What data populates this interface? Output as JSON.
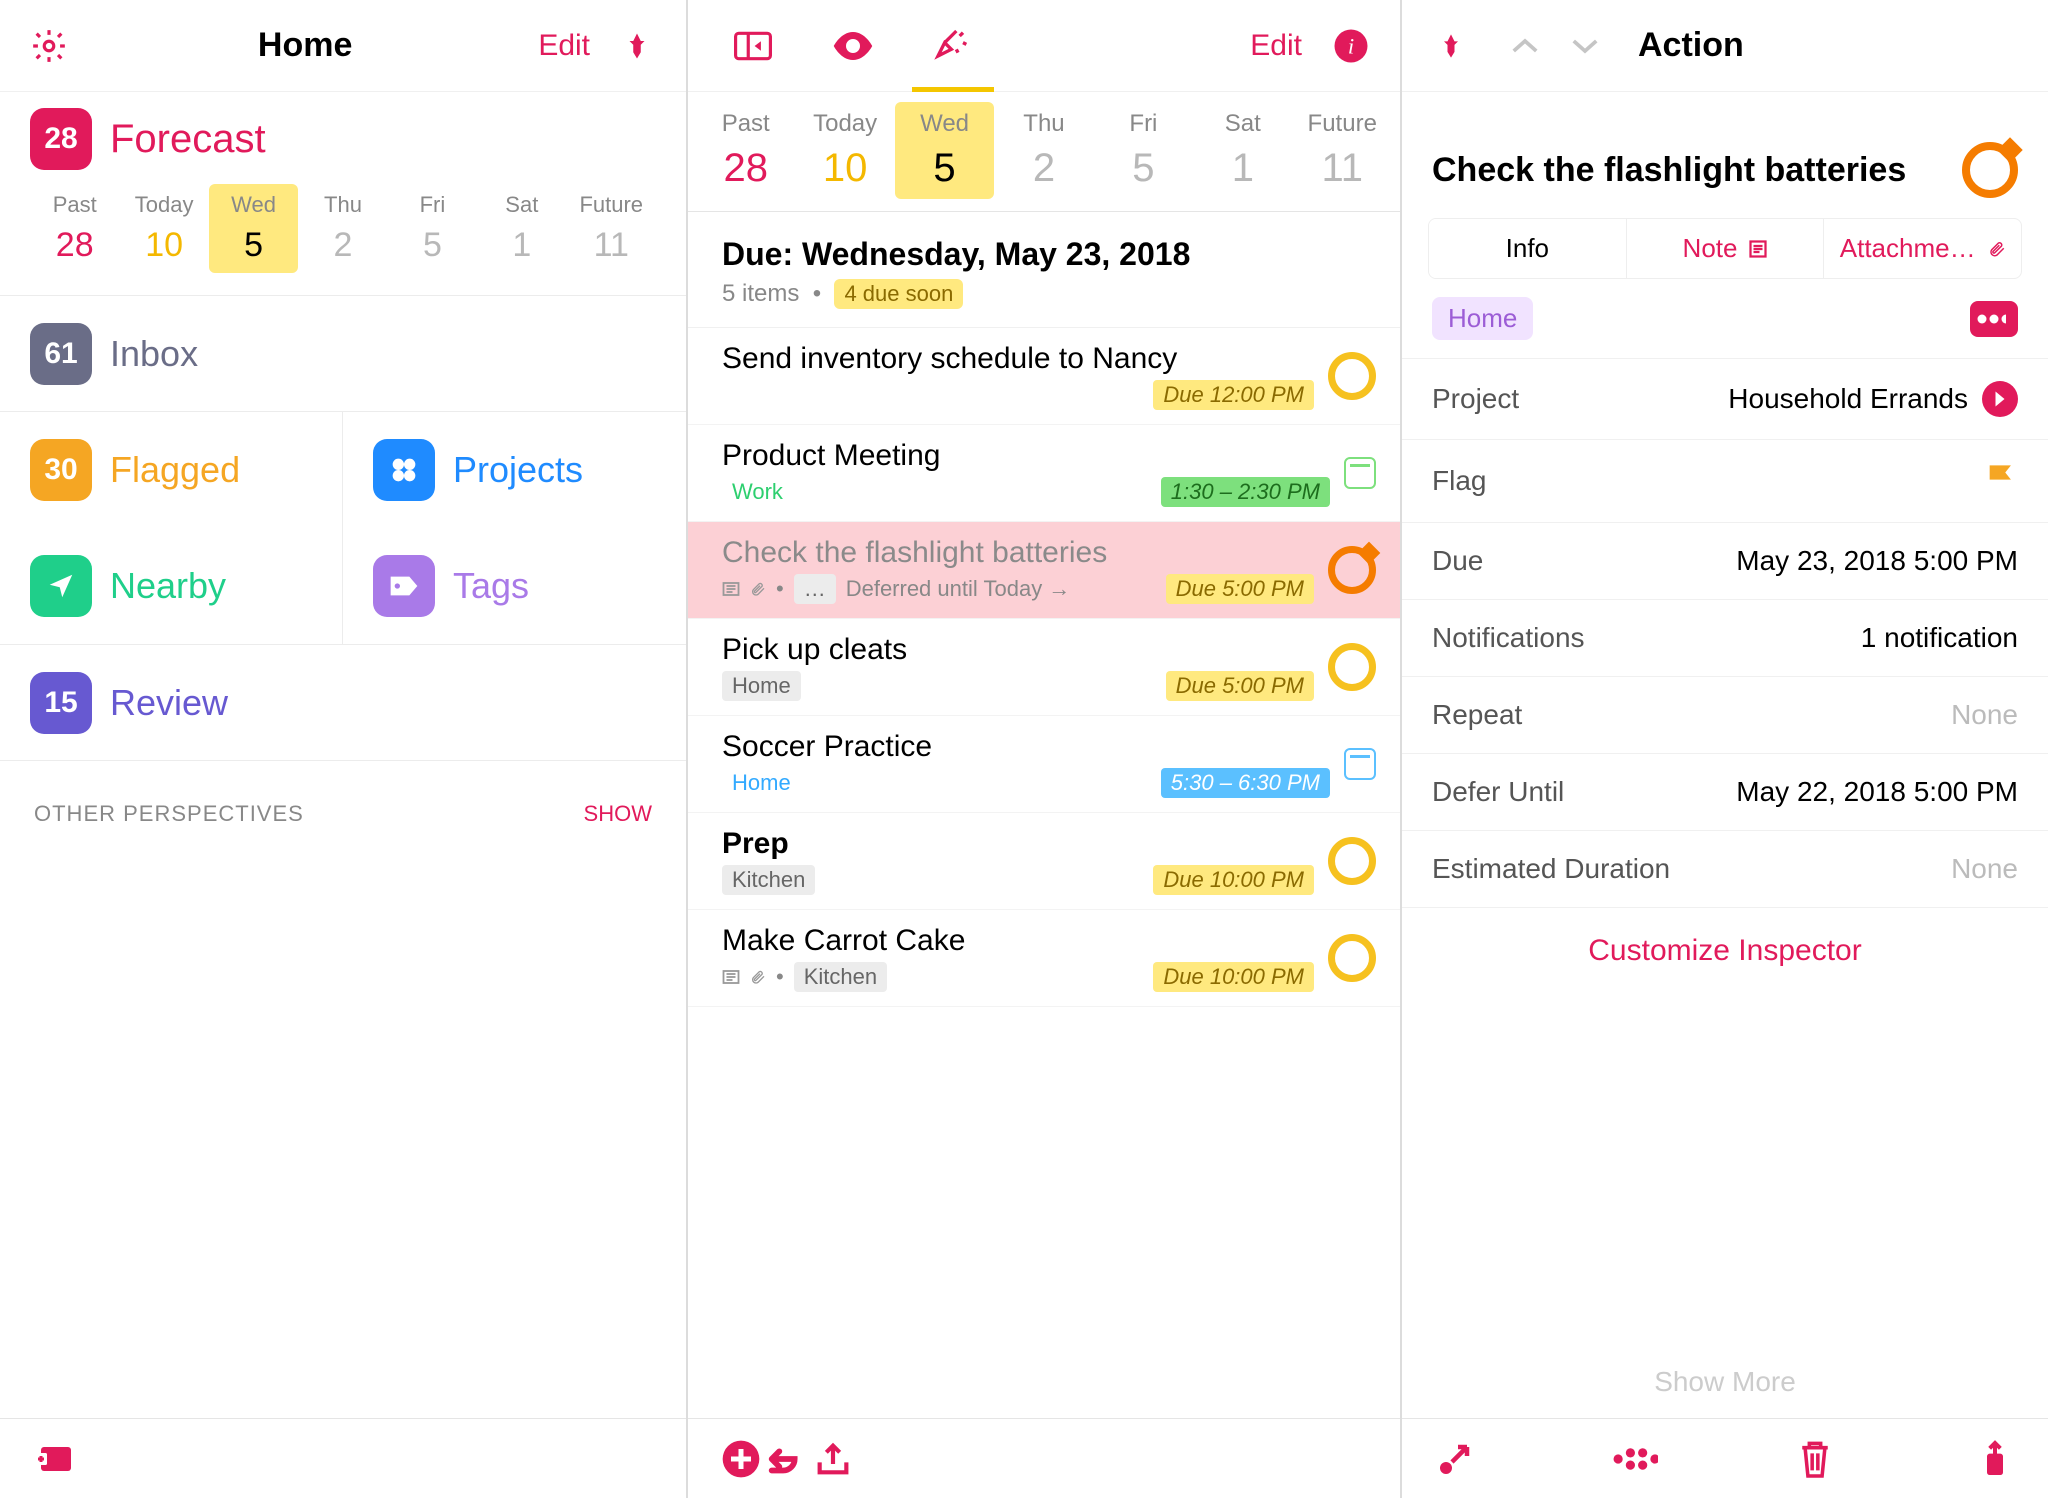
{
  "colors": {
    "accent": "#e11a5b"
  },
  "home": {
    "title": "Home",
    "edit": "Edit",
    "perspectives": {
      "forecast": {
        "label": "Forecast",
        "badge": "28"
      },
      "inbox": {
        "label": "Inbox",
        "badge": "61"
      },
      "flagged": {
        "label": "Flagged",
        "badge": "30"
      },
      "projects": {
        "label": "Projects"
      },
      "nearby": {
        "label": "Nearby"
      },
      "tags": {
        "label": "Tags"
      },
      "review": {
        "label": "Review",
        "badge": "15"
      }
    },
    "other_heading": "OTHER PERSPECTIVES",
    "show": "SHOW"
  },
  "days": [
    {
      "name": "Past",
      "num": "28",
      "state": "past"
    },
    {
      "name": "Today",
      "num": "10",
      "state": "today"
    },
    {
      "name": "Wed",
      "num": "5",
      "state": "sel"
    },
    {
      "name": "Thu",
      "num": "2",
      "state": ""
    },
    {
      "name": "Fri",
      "num": "5",
      "state": ""
    },
    {
      "name": "Sat",
      "num": "1",
      "state": ""
    },
    {
      "name": "Future",
      "num": "11",
      "state": ""
    }
  ],
  "tasklist": {
    "edit": "Edit",
    "group_header": "Due: Wednesday, May 23, 2018",
    "group_sub_count": "5 items",
    "group_sub_due": "4 due soon",
    "tasks": [
      {
        "title": "Send inventory schedule to Nancy",
        "due": "Due 12:00 PM",
        "circle": "yellow"
      },
      {
        "title": "Product Meeting",
        "tag": "Work",
        "tagStyle": "work-l",
        "time": "1:30 – 2:30 PM",
        "timeStyle": "green",
        "cal": "green"
      },
      {
        "title": "Check the flashlight batteries",
        "selected": true,
        "hasNote": true,
        "deferred": "Deferred until Today →",
        "due": "Due 5:00 PM",
        "dot": "…",
        "circle": "orange"
      },
      {
        "title": "Pick up cleats",
        "tagChip": "Home",
        "due": "Due 5:00 PM",
        "circle": "yellow"
      },
      {
        "title": "Soccer Practice",
        "tag": "Home",
        "tagStyle": "home-l",
        "time": "5:30 – 6:30 PM",
        "timeStyle": "blue",
        "cal": "blue"
      },
      {
        "title": "Prep",
        "bold": true,
        "tagChip": "Kitchen",
        "due": "Due 10:00 PM",
        "circle": "yellow"
      },
      {
        "title": "Make Carrot Cake",
        "hasNote": true,
        "tagChip": "Kitchen",
        "due": "Due 10:00 PM",
        "circle": "yellow"
      }
    ]
  },
  "inspector": {
    "header": "Action",
    "title": "Check the flashlight batteries",
    "tabs": {
      "info": "Info",
      "note": "Note",
      "att": "Attachme…"
    },
    "tag": "Home",
    "fields": {
      "project": {
        "label": "Project",
        "value": "Household Errands"
      },
      "flag": {
        "label": "Flag"
      },
      "due": {
        "label": "Due",
        "value": "May 23, 2018  5:00 PM"
      },
      "notif": {
        "label": "Notifications",
        "value": "1 notification"
      },
      "repeat": {
        "label": "Repeat",
        "value": "None"
      },
      "defer": {
        "label": "Defer Until",
        "value": "May 22, 2018  5:00 PM"
      },
      "estdur": {
        "label": "Estimated Duration",
        "value": "None"
      }
    },
    "customize": "Customize Inspector",
    "show_more": "Show More"
  }
}
